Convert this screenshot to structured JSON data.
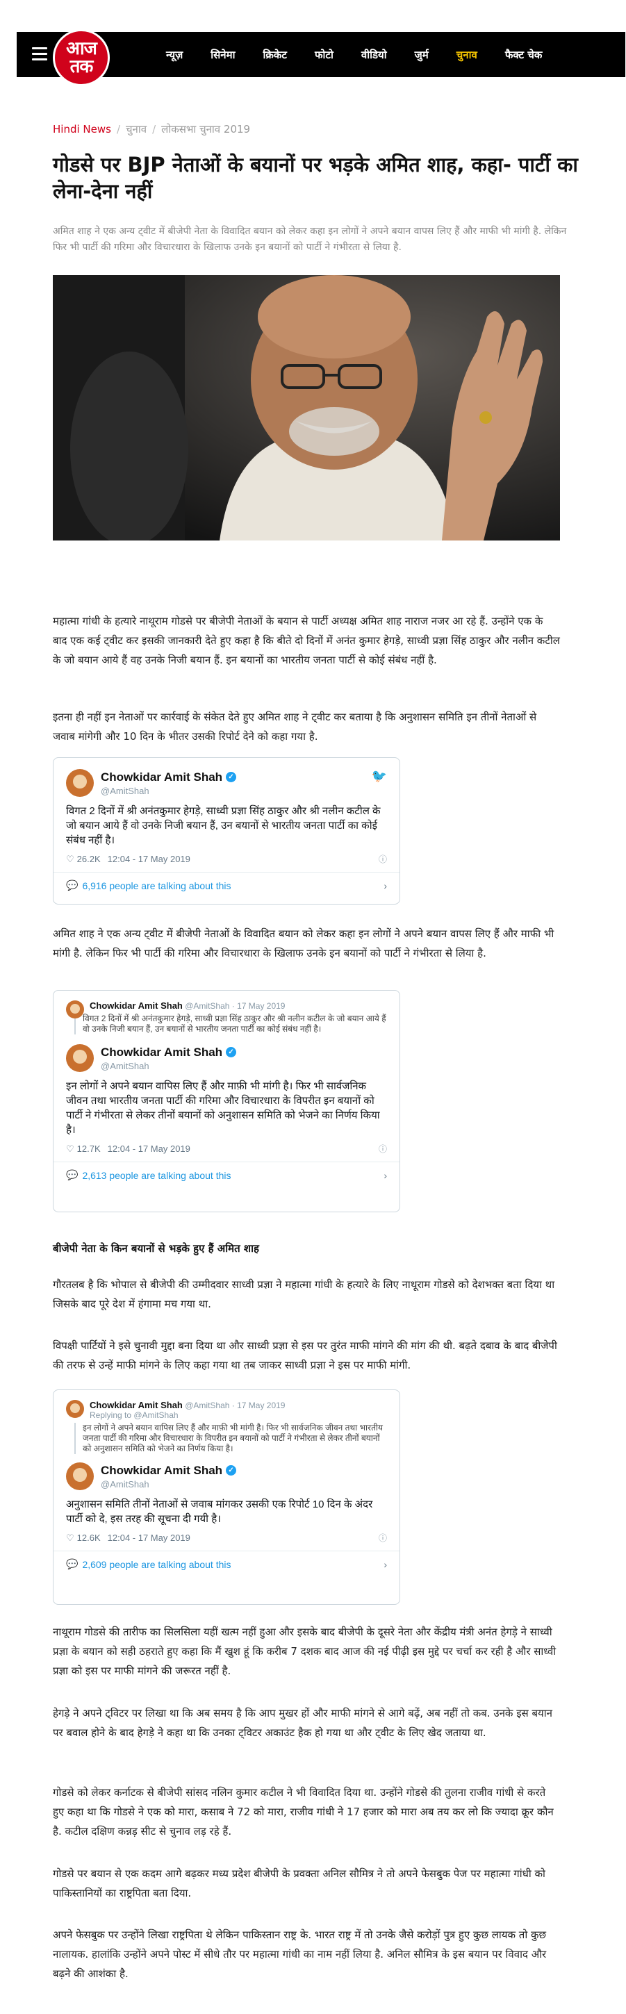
{
  "header": {
    "logo_text": "आज तक",
    "nav": [
      "न्यूज़",
      "सिनेमा",
      "क्रिकेट",
      "फोटो",
      "वीडियो",
      "जुर्म",
      "चुनाव",
      "फैक्ट चेक"
    ],
    "active_nav": "चुनाव",
    "brand_color": "#d0021b",
    "active_color": "#f5c400"
  },
  "breadcrumb": [
    "Hindi News",
    "चुनाव",
    "लोकसभा चुनाव 2019"
  ],
  "headline": "गोडसे पर BJP नेताओं के बयानों पर भड़के अमित शाह, कहा- पार्टी का लेना-देना नहीं",
  "summary": "अमित शाह ने एक अन्य ट्वीट में बीजेपी नेता के विवादित बयान को लेकर कहा इन लोगों ने अपने बयान वापस लिए हैं और माफी भी मांगी है. लेकिन फिर भी पार्टी की गरिमा और विचारधारा के खिलाफ उनके इन बयानों को पार्टी ने गंभीरता से लिया है.",
  "paragraphs": {
    "p1": "महात्मा गांधी के हत्यारे नाथूराम गोडसे पर बीजेपी नेताओं के बयान से पार्टी अध्यक्ष अमित शाह नाराज नजर आ रहे हैं. उन्होंने एक के बाद एक कई ट्वीट कर इसकी जानकारी देते हुए कहा है कि बीते दो दिनों में अनंत कुमार हेगड़े, साध्वी प्रज्ञा सिंह ठाकुर और नलीन कटील के जो बयान आये हैं वह उनके निजी बयान हैं. इन बयानों का भारतीय जनता पार्टी से कोई संबंध नहीं है.",
    "p2": "इतना ही नहीं इन नेताओं पर कार्रवाई के संकेत देते हुए अमित शाह ने ट्वीट कर बताया है कि अनुशासन समिति इन तीनों नेताओं से जवाब मांगेगी और 10 दिन के भीतर उसकी रिपोर्ट देने को कहा गया है.",
    "p3": "अमित शाह ने एक अन्य ट्वीट में बीजेपी नेताओं के विवादित बयान को लेकर कहा इन लोगों ने अपने बयान वापस लिए हैं और माफी भी मांगी है. लेकिन फिर भी पार्टी की गरिमा और विचारधारा के खिलाफ उनके इन बयानों को पार्टी ने गंभीरता से लिया है.",
    "subhead": "बीजेपी नेता के किन बयानों से भड़के हुए हैं अमित शाह",
    "p4": "गौरतलब है कि भोपाल से बीजेपी की उम्मीदवार साध्वी प्रज्ञा ने महात्मा गांधी के हत्यारे के लिए नाथूराम गोडसे को देशभक्त बता दिया था जिसके बाद पूरे देश में हंगामा मच गया था.",
    "p5": "विपक्षी पार्टियों ने इसे चुनावी मुद्दा बना दिया था और साध्वी प्रज्ञा से इस पर तुरंत माफी मांगने की मांग की थी. बढ़ते दबाव के बाद बीजेपी की तरफ से उन्हें माफी मांगने के लिए कहा गया था तब जाकर साध्वी प्रज्ञा ने इस पर माफी मांगी.",
    "p6": "नाथूराम गोडसे की तारीफ का सिलसिला यहीं खत्म नहीं हुआ और इसके बाद बीजेपी के दूसरे नेता और केंद्रीय मंत्री अनंत हेगड़े ने साध्वी प्रज्ञा के बयान को सही ठहराते हुए कहा कि मैं खुश हूं कि करीब 7 दशक बाद आज की नई पीढ़ी इस मुद्दे पर चर्चा कर रही है और साध्वी प्रज्ञा को इस पर माफी मांगने की जरूरत नहीं है.",
    "p7": "हेगड़े ने अपने ट्विटर पर लिखा था कि अब समय है कि आप मुखर हों और माफी मांगने से आगे बढ़ें, अब नहीं तो कब. उनके इस बयान पर बवाल होने के बाद हेगड़े ने कहा था कि उनका ट्विटर अकाउंट हैक हो गया था और ट्वीट के लिए खेद जताया था.",
    "p8": "गोडसे को लेकर कर्नाटक से बीजेपी सांसद नलिन कुमार कटील ने भी विवादित दिया था. उन्होंने गोडसे की तुलना राजीव गांधी से करते हुए कहा था कि गोडसे ने एक को मारा, कसाब ने 72 को मारा, राजीव गांधी ने 17 हजार को मारा अब तय कर लो कि ज्यादा क्रूर कौन है. कटील दक्षिण कन्नड़ सीट से चुनाव लड़ रहे हैं.",
    "p9": "गोडसे पर बयान से एक कदम आगे बढ़कर मध्य प्रदेश बीजेपी के प्रवक्ता अनिल सौमित्र ने तो अपने फेसबुक पेज पर महात्मा गांधी को पाकिस्तानियों का राष्ट्रपिता बता दिया.",
    "p10": "अपने फेसबुक पर उन्होंने लिखा राष्ट्रपिता थे लेकिन पाकिस्तान राष्ट्र के. भारत राष्ट्र में तो उनके जैसे करोड़ों पुत्र हुए कुछ लायक तो कुछ नालायक. हालांकि उन्होंने अपने पोस्ट में सीधे तौर पर महात्मा गांधी का नाम नहीं लिया है. अनिल सौमित्र के इस बयान पर विवाद और बढ़ने की आशंका है."
  },
  "tweets": [
    {
      "name": "Chowkidar Amit Shah",
      "handle": "@AmitShah",
      "text": "विगत 2 दिनों में श्री अनंतकुमार हेगड़े, साध्वी प्रज्ञा सिंह ठाकुर और श्री नलीन कटील के जो बयान आये हैं वो उनके निजी बयान हैं, उन बयानों से भारतीय जनता पार्टी का कोई संबंध नहीं है।",
      "likes": "26.2K",
      "time": "12:04 - 17 May 2019",
      "talking": "6,916 people are talking about this"
    },
    {
      "quote_name": "Chowkidar Amit Shah",
      "quote_meta": "@AmitShah · 17 May 2019",
      "quote_text": "विगत 2 दिनों में श्री अनंतकुमार हेगड़े, साध्वी प्रज्ञा सिंह ठाकुर और श्री नलीन कटील के जो बयान आये हैं वो उनके निजी बयान हैं, उन बयानों से भारतीय जनता पार्टी का कोई संबंध नहीं है।",
      "name": "Chowkidar Amit Shah",
      "handle": "@AmitShah",
      "text": "इन लोगों ने अपने बयान वापिस लिए हैं और माफ़ी भी मांगी है। फिर भी सार्वजनिक जीवन तथा भारतीय जनता पार्टी की गरिमा और विचारधारा के विपरीत इन बयानों को पार्टी ने गंभीरता से लेकर तीनों बयानों को अनुशासन समिति को भेजने का निर्णय किया है।",
      "likes": "12.7K",
      "time": "12:04 - 17 May 2019",
      "talking": "2,613 people are talking about this"
    },
    {
      "quote_name": "Chowkidar Amit Shah",
      "quote_meta": "@AmitShah · 17 May 2019",
      "quote_reply": "Replying to @AmitShah",
      "quote_text": "इन लोगों ने अपने बयान वापिस लिए हैं और माफ़ी भी मांगी है। फिर भी सार्वजनिक जीवन तथा भारतीय जनता पार्टी की गरिमा और विचारधारा के विपरीत इन बयानों को पार्टी ने गंभीरता से लेकर तीनों बयानों को अनुशासन समिति को भेजने का निर्णय किया है।",
      "name": "Chowkidar Amit Shah",
      "handle": "@AmitShah",
      "text": "अनुशासन समिति तीनों नेताओं से जवाब मांगकर उसकी एक रिपोर्ट 10 दिन के अंदर पार्टी को दे, इस तरह की सूचना दी गयी है।",
      "likes": "12.6K",
      "time": "12:04 - 17 May 2019",
      "talking": "2,609 people are talking about this"
    }
  ]
}
